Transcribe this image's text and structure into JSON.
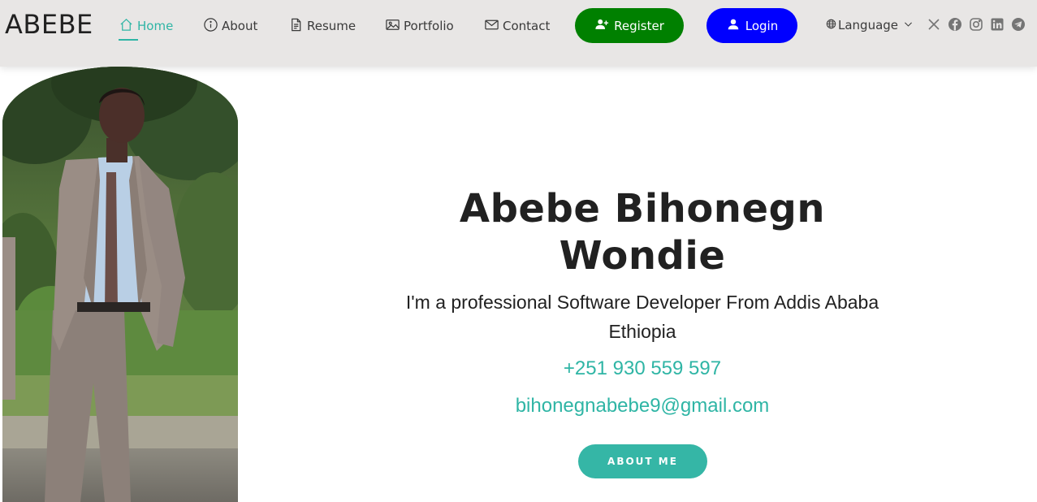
{
  "header": {
    "brand": "ABEBE",
    "nav": [
      {
        "label": "Home",
        "icon": "home-icon",
        "active": true
      },
      {
        "label": "About",
        "icon": "info-icon",
        "active": false
      },
      {
        "label": "Resume",
        "icon": "document-icon",
        "active": false
      },
      {
        "label": "Portfolio",
        "icon": "images-icon",
        "active": false
      },
      {
        "label": "Contact",
        "icon": "envelope-icon",
        "active": false
      }
    ],
    "register_label": "Register",
    "login_label": "Login",
    "language_label": "Language",
    "social": [
      "x-icon",
      "facebook-icon",
      "instagram-icon",
      "linkedin-icon",
      "telegram-icon"
    ]
  },
  "hero": {
    "name": "Abebe Bihonegn Wondie",
    "description": "I'm a professional Software Developer From Addis Ababa Ethiopia",
    "phone": "+251 930 559 597",
    "email": "bihonegnabebe9@gmail.com",
    "button_label": "ABOUT ME"
  },
  "colors": {
    "accent": "#2fb5a5",
    "register": "#008000",
    "login": "#0000ff",
    "header_bg": "#e8e6e5",
    "social_icon": "#757575"
  }
}
